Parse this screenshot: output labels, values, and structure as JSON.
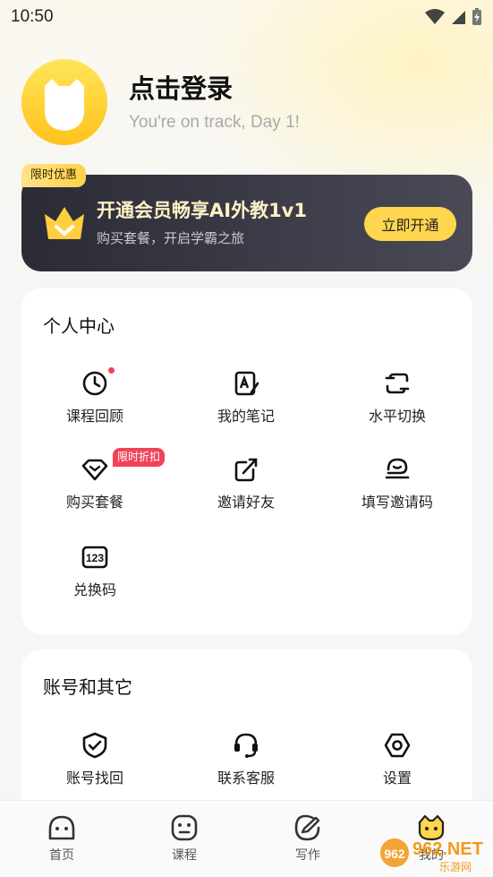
{
  "status_bar": {
    "time": "10:50"
  },
  "profile": {
    "login_title": "点击登录",
    "subtitle": "You're on track, Day 1!"
  },
  "promo": {
    "tag": "限时优惠",
    "title": "开通会员畅享AI外教1v1",
    "subtitle": "购买套餐，开启学霸之旅",
    "button": "立即开通"
  },
  "personal_center": {
    "title": "个人中心",
    "items": [
      {
        "label": "课程回顾",
        "icon": "clock-icon",
        "has_dot": true
      },
      {
        "label": "我的笔记",
        "icon": "notebook-icon"
      },
      {
        "label": "水平切换",
        "icon": "switch-icon"
      },
      {
        "label": "购买套餐",
        "icon": "diamond-icon",
        "badge": "限时折扣"
      },
      {
        "label": "邀请好友",
        "icon": "edit-share-icon"
      },
      {
        "label": "填写邀请码",
        "icon": "invite-code-icon"
      },
      {
        "label": "兑换码",
        "icon": "redeem-code-icon",
        "icon_text": "123"
      }
    ]
  },
  "account": {
    "title": "账号和其它",
    "items": [
      {
        "label": "账号找回",
        "icon": "shield-check-icon"
      },
      {
        "label": "联系客服",
        "icon": "headset-icon"
      },
      {
        "label": "设置",
        "icon": "settings-icon"
      }
    ]
  },
  "tabbar": {
    "tabs": [
      {
        "label": "首页",
        "icon": "home-face-icon"
      },
      {
        "label": "课程",
        "icon": "course-face-icon"
      },
      {
        "label": "写作",
        "icon": "writing-icon"
      },
      {
        "label": "我的",
        "icon": "mascot-icon",
        "active": true
      }
    ]
  },
  "watermark": {
    "text": "962.NET",
    "sub": "乐游网"
  },
  "colors": {
    "accent": "#ffd64d",
    "badge_red": "#f0435a",
    "promo_bg": "#2b2b36"
  }
}
